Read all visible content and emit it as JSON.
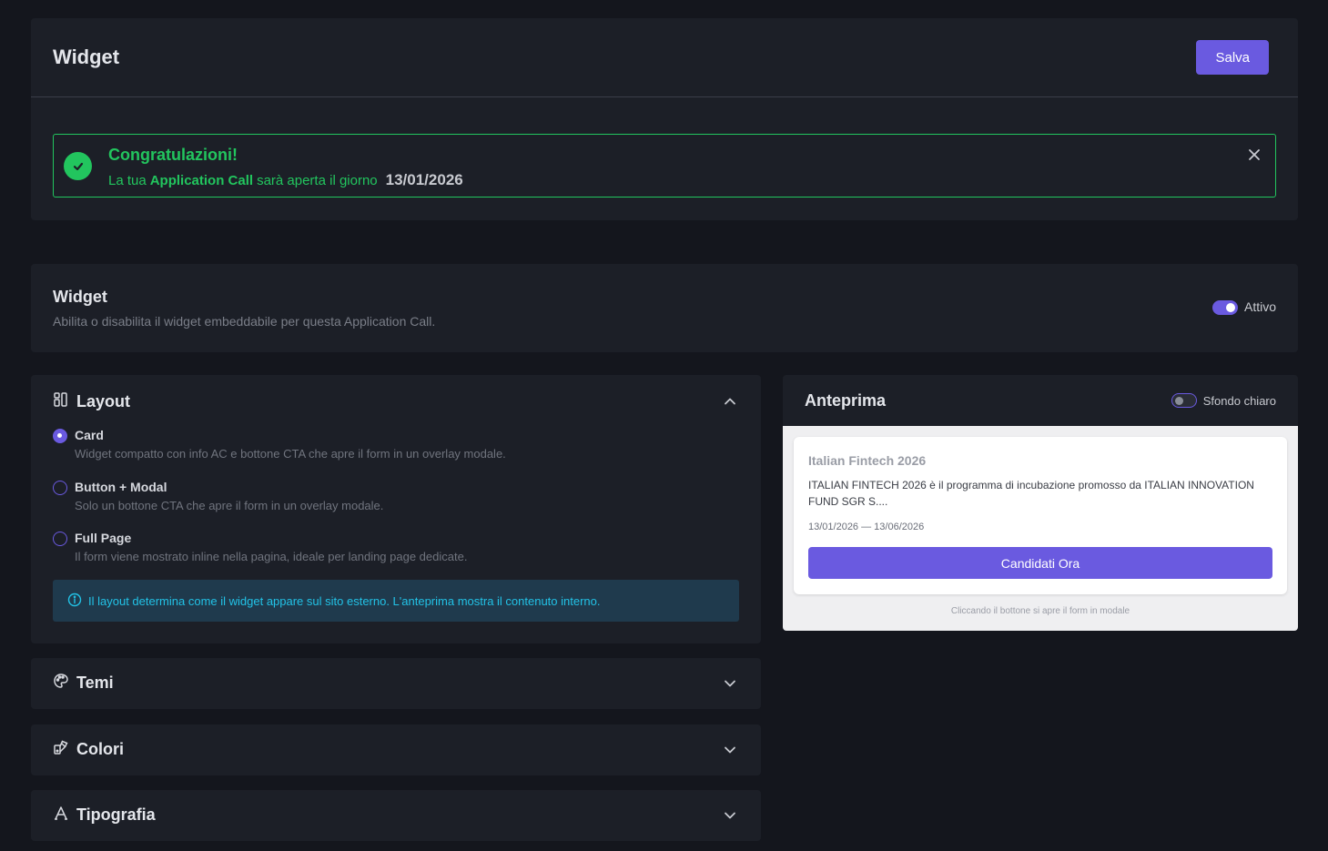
{
  "header": {
    "title": "Widget",
    "save_label": "Salva"
  },
  "alert": {
    "title": "Congratulazioni!",
    "msg_prefix": "La tua",
    "msg_bold": "Application Call",
    "msg_suffix": "sarà aperta il giorno",
    "date": "13/01/2026",
    "accent_color": "#22c55e"
  },
  "widget_section": {
    "title": "Widget",
    "description": "Abilita o disabilita il widget embeddabile per questa Application Call.",
    "toggle_label": "Attivo",
    "toggle_on": true
  },
  "layout_section": {
    "title": "Layout",
    "options": [
      {
        "label": "Card",
        "description": "Widget compatto con info AC e bottone CTA che apre il form in un overlay modale.",
        "selected": true
      },
      {
        "label": "Button + Modal",
        "description": "Solo un bottone CTA che apre il form in un overlay modale.",
        "selected": false
      },
      {
        "label": "Full Page",
        "description": "Il form viene mostrato inline nella pagina, ideale per landing page dedicate.",
        "selected": false
      }
    ],
    "info": "Il layout determina come il widget appare sul sito esterno. L'anteprima mostra il contenuto interno."
  },
  "accordions": [
    {
      "title": "Temi",
      "icon": "palette-icon"
    },
    {
      "title": "Colori",
      "icon": "swatches-icon"
    },
    {
      "title": "Tipografia",
      "icon": "typography-icon"
    }
  ],
  "preview": {
    "title": "Anteprima",
    "toggle_label": "Sfondo chiaro",
    "toggle_on": false,
    "card_title": "Italian Fintech 2026",
    "card_description": "ITALIAN FINTECH 2026 è il programma di incubazione promosso da ITALIAN INNOVATION FUND SGR S....",
    "card_dates": "13/01/2026 — 13/06/2026",
    "cta_label": "Candidati Ora",
    "note": "Cliccando il bottone si apre il form in modale"
  },
  "colors": {
    "primary": "#6a5ae0",
    "success": "#22c55e",
    "info_text": "#22c2e6"
  }
}
